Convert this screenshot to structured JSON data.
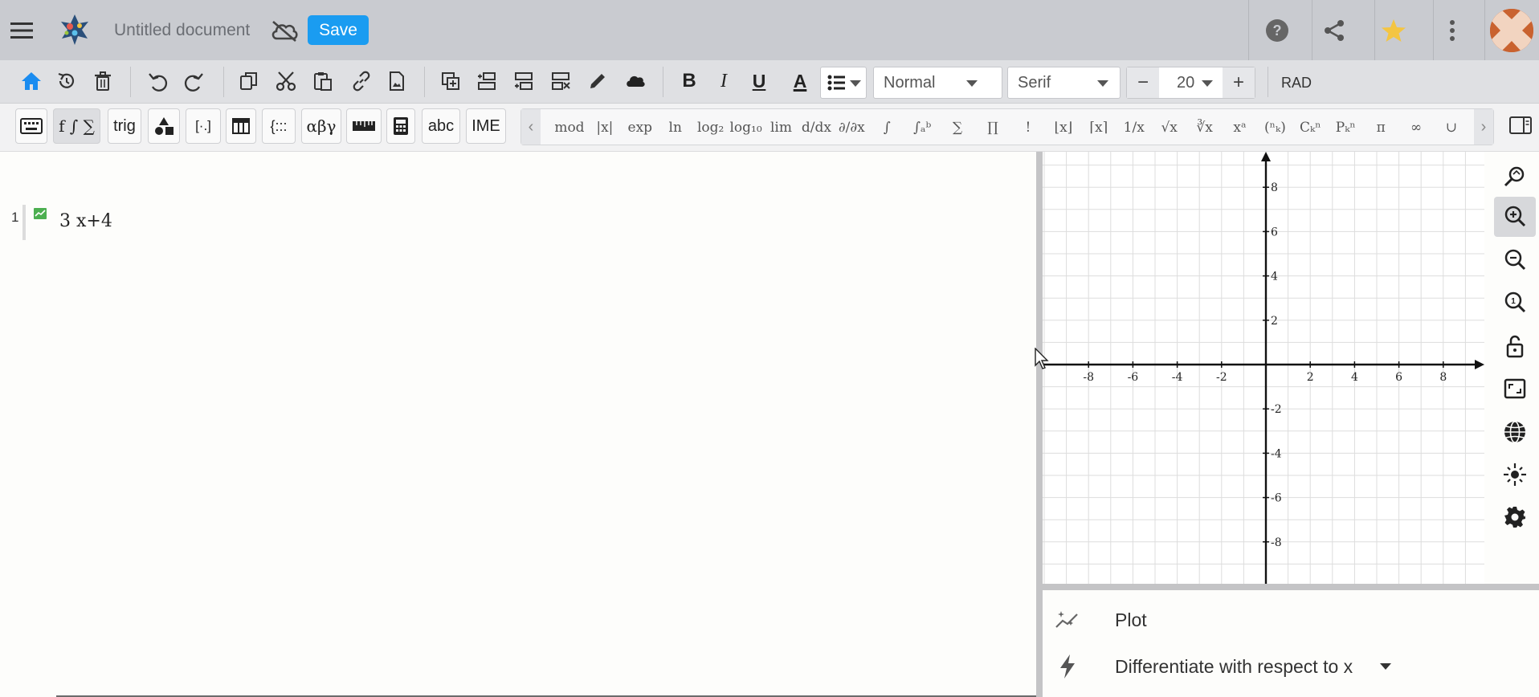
{
  "app": {
    "document_title": "Untitled document",
    "save_label": "Save",
    "icons": [
      "menu-icon",
      "app-logo-icon",
      "cloud-off-icon",
      "help-icon",
      "share-icon",
      "star-icon",
      "more-vert-icon"
    ],
    "colors": {
      "save_button": "#1a9cf1",
      "titlebar": "#c9cbd0",
      "home_icon": "#1a8cf0",
      "star": "#f4c542",
      "plot_line_marker": "#4caf50"
    }
  },
  "format_toolbar": {
    "paragraph_style": "Normal",
    "font_family": "Serif",
    "font_size": "20",
    "decrease_label": "−",
    "increase_label": "+",
    "angle_mode": "RAD",
    "bold_label": "B",
    "italic_label": "I",
    "underline_label": "U",
    "color_label": "A"
  },
  "palette": {
    "tabs": [
      {
        "id": "keyboard",
        "label": ""
      },
      {
        "id": "calculus",
        "label": "f ∫ ∑"
      },
      {
        "id": "trig",
        "label": "trig"
      },
      {
        "id": "shapes",
        "label": ""
      },
      {
        "id": "matrix",
        "label": "[·.]"
      },
      {
        "id": "table",
        "label": ""
      },
      {
        "id": "piecewise",
        "label": "{:::"
      },
      {
        "id": "greek",
        "label": "αβγ"
      },
      {
        "id": "units",
        "label": ""
      },
      {
        "id": "calculator",
        "label": ""
      },
      {
        "id": "text",
        "label": "abc"
      },
      {
        "id": "ime",
        "label": "IME"
      }
    ],
    "symbols": [
      "mod",
      "|x|",
      "exp",
      "ln",
      "log₂",
      "log₁₀",
      "lim",
      "d/dx",
      "∂/∂x",
      "∫",
      "∫ₐᵇ",
      "∑",
      "∏",
      "!",
      "⌊x⌋",
      "⌈x⌉",
      "1/x",
      "√x",
      "∛x",
      "xᵃ",
      "(ⁿₖ)",
      "Cₖⁿ",
      "Pₖⁿ",
      "π",
      "∞",
      "∪"
    ]
  },
  "document": {
    "lines": [
      {
        "number": "1",
        "expression": "3 x+4"
      }
    ]
  },
  "graph": {
    "x_ticks": [
      "-8",
      "-6",
      "-4",
      "-2",
      "2",
      "4",
      "6",
      "8"
    ],
    "y_ticks": [
      "8",
      "6",
      "4",
      "2",
      "-2",
      "-4",
      "-6",
      "-8"
    ],
    "x_range": [
      -10,
      10
    ],
    "y_range": [
      -10,
      10
    ],
    "grid": true,
    "tools": [
      "zoom-fit-icon",
      "zoom-in-icon",
      "zoom-out-icon",
      "zoom-reset-icon",
      "lock-icon",
      "fullscreen-icon",
      "globe-icon",
      "center-icon",
      "settings-icon"
    ]
  },
  "actions": {
    "plot_label": "Plot",
    "differentiate_label": "Differentiate with respect to x"
  }
}
